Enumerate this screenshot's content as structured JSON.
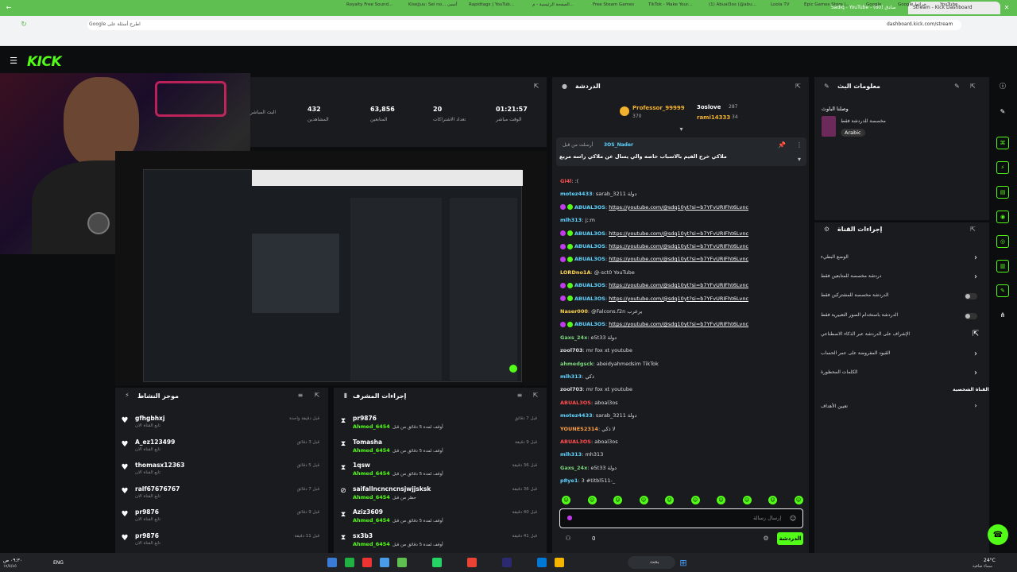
{
  "browser": {
    "tabs": [
      {
        "title": "Stream - Kick Dashboard",
        "active": true
      },
      {
        "title": "Sadiq - YouTube - (60) صادق",
        "active": false
      }
    ],
    "address": "dashboard.kick.com/stream",
    "search_placeholder": "Google اطرح أسئلة على",
    "bookmarks": [
      "Royalty Free Sound...",
      "Kisejjuu: Sei no... أنسى",
      "Rapidtags | YouTub...",
      "الصفحة الرئيسية - م...",
      "Free Steam Games",
      "TikTok - Make Your...",
      "(1) Abual3os (@abu...",
      "Loola TV",
      "Epic Games Store |...",
      "Google",
      "Google خرائط",
      "YouTube"
    ]
  },
  "app": {
    "logo": "KICK"
  },
  "stats": [
    {
      "value": "01:21:57",
      "label": "الوقت مباشر"
    },
    {
      "value": "20",
      "label": "تعداد الاشتراكات"
    },
    {
      "value": "63,856",
      "label": "المتابعين"
    },
    {
      "value": "432",
      "label": "المشاهدين"
    },
    {
      "value": "",
      "label": "البث المباشر"
    }
  ],
  "chat": {
    "title": "الدردشة",
    "top_gifters": [
      {
        "name": "Professor_99999",
        "count": "370"
      },
      {
        "name": "3oslove",
        "count": "287"
      },
      {
        "name": "rami14333",
        "count": "34"
      }
    ],
    "pinned_by": "3OS_Nader",
    "pinned_label": "أرسلت من قبل",
    "pinned_text": "ملاكي خرج الفيم بالاسباب خاصه والي يسال عن ملاكي راسه مربع",
    "messages": [
      {
        "user": "Gi4l",
        "color": "#ff5252",
        "text": ":( "
      },
      {
        "user": "motez4433",
        "color": "#5fd3ff",
        "text": "sarab_3211 دولة"
      },
      {
        "user": "ABUAL3OS",
        "color": "#5fd3ff",
        "text": "https://youtube.com/@sdq10yt?si=b7YFvURIFht6Lvnc",
        "badges": true
      },
      {
        "user": "mlh313",
        "color": "#5fd3ff",
        "text": "j;:m"
      },
      {
        "user": "ABUAL3OS",
        "color": "#5fd3ff",
        "text": "https://youtube.com/@sdq10yt?si=b7YFvURIFht6Lvnc",
        "badges": true
      },
      {
        "user": "ABUAL3OS",
        "color": "#5fd3ff",
        "text": "https://youtube.com/@sdq10yt?si=b7YFvURIFht6Lvnc",
        "badges": true
      },
      {
        "user": "ABUAL3OS",
        "color": "#5fd3ff",
        "text": "https://youtube.com/@sdq10yt?si=b7YFvURIFht6Lvnc",
        "badges": true
      },
      {
        "user": "LORDno1A",
        "color": "#ffd54f",
        "text": "@-sct0 YouTube"
      },
      {
        "user": "ABUAL3OS",
        "color": "#5fd3ff",
        "text": "https://youtube.com/@sdq10yt?si=b7YFvURIFht6Lvnc",
        "badges": true
      },
      {
        "user": "ABUAL3OS",
        "color": "#5fd3ff",
        "text": "https://youtube.com/@sdq10yt?si=b7YFvURIFht6Lvnc",
        "badges": true
      },
      {
        "user": "Naser000",
        "color": "#ffd54f",
        "text": "@Falcons.f2n يرعرب"
      },
      {
        "user": "ABUAL3OS",
        "color": "#5fd3ff",
        "text": "https://youtube.com/@sdq10yt?si=b7YFvURIFht6Lvnc",
        "badges": true
      },
      {
        "user": "Gaxs_24x",
        "color": "#7cd67c",
        "text": "e5t33 دولة"
      },
      {
        "user": "zool703",
        "color": "#ddd",
        "text": "mr fox xt youtube"
      },
      {
        "user": "ahmedgsck",
        "color": "#7cd67c",
        "text": "abeidyahmedsim TikTok"
      },
      {
        "user": "mlh313",
        "color": "#5fd3ff",
        "text": "ذكي"
      },
      {
        "user": "zool703",
        "color": "#ddd",
        "text": "mr fox xt youtube"
      },
      {
        "user": "ABUAL3OS",
        "color": "#ff4d4d",
        "text": "aboal3os"
      },
      {
        "user": "motez4433",
        "color": "#5fd3ff",
        "text": "sarab_3211 دولة"
      },
      {
        "user": "YOUNES2314",
        "color": "#ff9f43",
        "text": "لا ذكي"
      },
      {
        "user": "ABUAL3OS",
        "color": "#ff4d4d",
        "text": "aboal3os"
      },
      {
        "user": "mlh313",
        "color": "#5fd3ff",
        "text": "mh313"
      },
      {
        "user": "Gaxs_24x",
        "color": "#7cd67c",
        "text": "e5t33 دولة"
      },
      {
        "user": "p8ye1",
        "color": "#5fd3ff",
        "text": "3 #titbl511-_"
      }
    ],
    "input_placeholder": "إرسال رسالة",
    "send_button": "الدردشة",
    "viewer_count": "0"
  },
  "stream_info": {
    "title": "معلومات البث",
    "subtitle": "وصلنا الباوث",
    "category": "مخصصة للدردشة فقط",
    "language": "Arabic"
  },
  "channel_actions": {
    "title": "إجراءات القناة",
    "items": [
      {
        "label": "الوضع البطيء",
        "type": "arrow"
      },
      {
        "label": "دردشة مخصصة للمتابعين فقط",
        "type": "arrow"
      },
      {
        "label": "الدردشة مخصصة للمشتركين فقط",
        "type": "toggle"
      },
      {
        "label": "الدردشة باستخدام الصور التعبيرية فقط",
        "type": "toggle"
      },
      {
        "label": "الإشراف على الدردشة عبر الذكاء الاصطناعي",
        "type": "link"
      },
      {
        "label": "القيود المفروضة على عمر الحساب",
        "type": "arrow"
      },
      {
        "label": "الكلمات المحظورة",
        "type": "arrow"
      }
    ],
    "section": "القناة الشخصية",
    "goals": "تعيين الأهداف"
  },
  "activity": {
    "title": "موجز النشاط",
    "items": [
      {
        "name": "gfhgbhxj",
        "sub": "تابع القناة الان",
        "time": "قبل دقيقة واحدة"
      },
      {
        "name": "A_ez123499",
        "sub": "تابع القناة الان",
        "time": "قبل 3 دقائق"
      },
      {
        "name": "thomasx12363",
        "sub": "تابع القناة الان",
        "time": "قبل 5 دقائق"
      },
      {
        "name": "ralf67676767",
        "sub": "تابع القناة الان",
        "time": "قبل 7 دقائق"
      },
      {
        "name": "pr9876",
        "sub": "تابع القناة الان",
        "time": "قبل 9 دقائق"
      },
      {
        "name": "pr9876",
        "sub": "تابع القناة الان",
        "time": "قبل 11 دقيقة"
      }
    ]
  },
  "mod_actions": {
    "title": "إجراءات المشرف",
    "items": [
      {
        "name": "pr9876",
        "action": "أوقف لمدة 5 دقائق من قبل",
        "mod": "Ahmed_6454",
        "time": "قبل 7 دقائق"
      },
      {
        "name": "Tomasha",
        "action": "أوقف لمدة 5 دقائق من قبل",
        "mod": "Ahmed_6454",
        "time": "قبل 9 دقيقة"
      },
      {
        "name": "1qsw",
        "action": "أوقف لمدة 5 دقائق من قبل",
        "mod": "Ahmed_6454",
        "time": "قبل 36 دقيقة"
      },
      {
        "name": "saifallncncncnsjwjjsksk",
        "action": "حظر من قبل",
        "mod": "Ahmed_6454",
        "time": "قبل 36 دقيقة"
      },
      {
        "name": "Aziz3609",
        "action": "أوقف لمدة 5 دقائق من قبل",
        "mod": "Ahmed_6454",
        "time": "قبل 40 دقيقة"
      },
      {
        "name": "sx3b3",
        "action": "أوقف لمدة 5 دقائق من قبل",
        "mod": "Ahmed_6454",
        "time": "قبل 41 دقيقة"
      }
    ]
  },
  "taskbar": {
    "search": "بحث",
    "lang": "ENG",
    "clock": "٠٩:٣٠ ص",
    "date": "١٧/٥/٤٥",
    "weather": "24°C",
    "weather_text": "سماء صافية"
  },
  "colors": {
    "accent": "#53fc18",
    "panel": "#191b1f",
    "bg": "#0b0d0f"
  }
}
